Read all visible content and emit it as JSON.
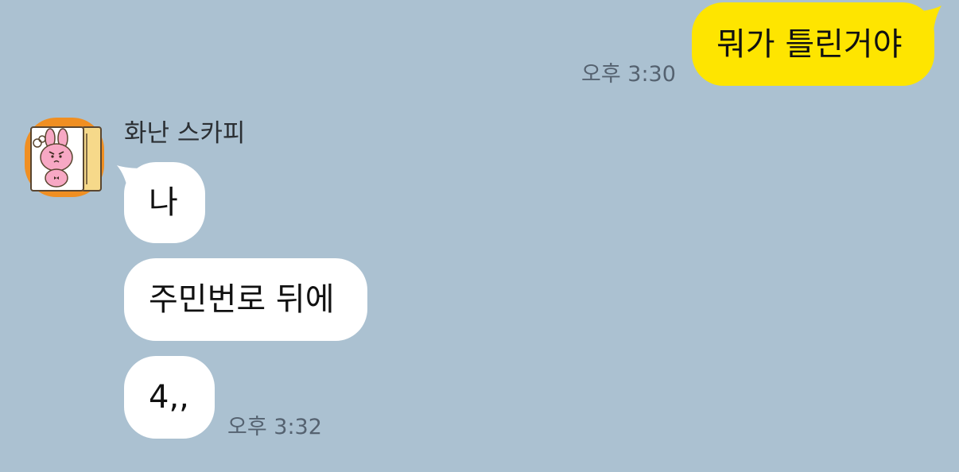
{
  "colors": {
    "background": "#abc1d1",
    "my_bubble": "#fee500",
    "their_bubble": "#ffffff",
    "timestamp": "#556270",
    "avatar_frame": "#f08f22"
  },
  "messages": {
    "outgoing": {
      "text": "뭐가 틀린거야",
      "time": "오후 3:30"
    },
    "incoming": {
      "sender_name": "화난 스카피",
      "avatar_icon": "angry-pink-bunny-avatar-icon",
      "bubbles": [
        {
          "text": "나"
        },
        {
          "text": "주민번로 뒤에"
        },
        {
          "text": "4,,"
        }
      ],
      "time": "오후 3:32"
    }
  }
}
